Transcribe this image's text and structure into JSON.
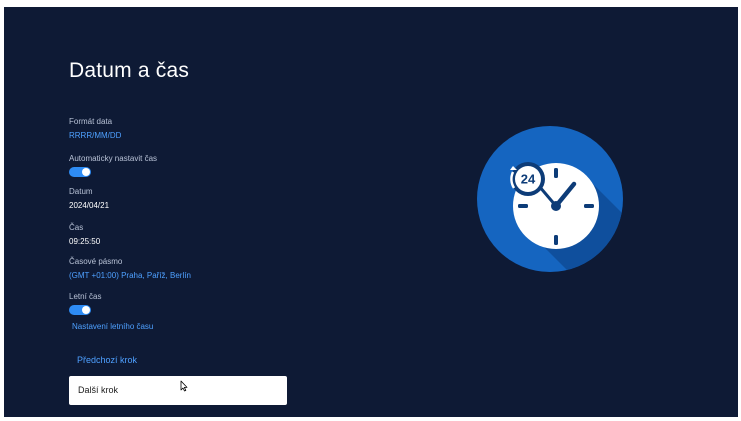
{
  "page": {
    "title": "Datum a čas"
  },
  "settings": {
    "date_format": {
      "label": "Formát data",
      "value": "RRRR/MM/DD"
    },
    "auto_time": {
      "label": "Automaticky nastavit čas",
      "enabled": true
    },
    "date": {
      "label": "Datum",
      "value": "2024/04/21"
    },
    "time": {
      "label": "Čas",
      "value": "09:25:50"
    },
    "timezone": {
      "label": "Časové pásmo",
      "value": "(GMT +01:00) Praha, Paříž, Berlín"
    },
    "dst": {
      "label": "Letní čas",
      "enabled": true
    },
    "dst_settings_link": "Nastavení letního času"
  },
  "navigation": {
    "previous_label": "Předchozí krok",
    "next_label": "Další krok"
  },
  "illustration": {
    "icon": "clock-24h-icon",
    "badge_text": "24"
  },
  "colors": {
    "background": "#0e1a35",
    "accent": "#2e8cf5",
    "link": "#4ea0ff",
    "clock_circle": "#1565c0"
  }
}
